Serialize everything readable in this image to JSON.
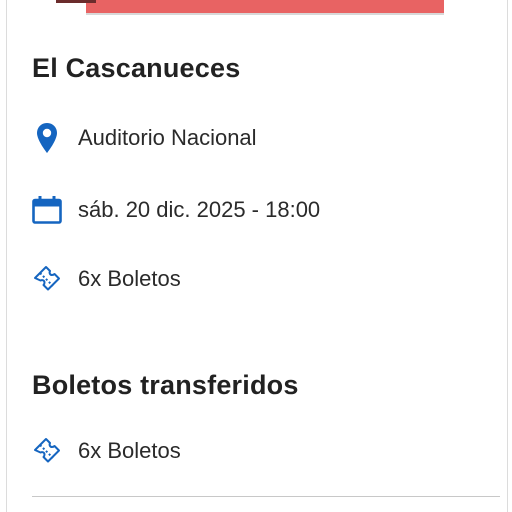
{
  "event": {
    "title": "El Cascanueces",
    "venue": "Auditorio Nacional",
    "datetime": "sáb. 20 dic. 2025 - 18:00",
    "tickets": "6x Boletos"
  },
  "transferred": {
    "title": "Boletos transferidos",
    "tickets": "6x Boletos"
  },
  "icons": {
    "venue": "map-pin-icon",
    "date": "calendar-icon",
    "tickets": "ticket-icon"
  },
  "colors": {
    "accent": "#1565c0",
    "banner": "#e86363"
  }
}
